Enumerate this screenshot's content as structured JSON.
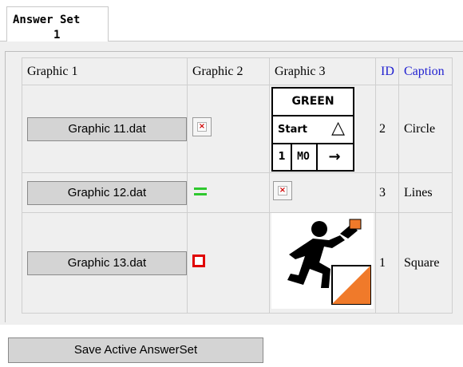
{
  "tab": {
    "line1": "Answer Set",
    "line2": "1"
  },
  "table": {
    "headers": [
      "Graphic 1",
      "Graphic 2",
      "Graphic 3",
      "ID",
      "Caption"
    ],
    "rows": [
      {
        "graphic1": "Graphic 11.dat",
        "graphic2_icon": "broken-image-icon",
        "graphic3": "sign",
        "id": "2",
        "caption": "Circle"
      },
      {
        "graphic1": "Graphic 12.dat",
        "graphic2_icon": "green-lines-icon",
        "graphic3": "broken-image",
        "id": "3",
        "caption": "Lines"
      },
      {
        "graphic1": "Graphic 13.dat",
        "graphic2_icon": "red-square-icon",
        "graphic3": "orienteering-runner-image",
        "id": "1",
        "caption": "Square"
      }
    ]
  },
  "sign": {
    "row1": "GREEN",
    "row2": "Start",
    "row3_a": "1",
    "row3_b": "MO"
  },
  "bottom": {
    "save_label": "Save Active AnswerSet"
  },
  "colors": {
    "blue_header": "#1f1fd0",
    "green_lines": "#2ec82e",
    "red_square": "#e00000",
    "orange_flag": "#f07a2a"
  }
}
